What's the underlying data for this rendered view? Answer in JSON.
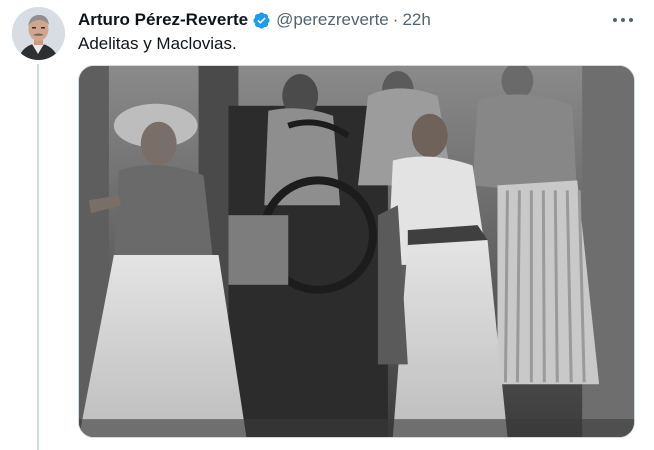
{
  "author": {
    "display_name": "Arturo Pérez-Reverte",
    "handle": "@perezreverte",
    "separator": "·",
    "time": "22h"
  },
  "tweet": {
    "text": "Adelitas y Maclovias."
  },
  "icons": {
    "verified": "verified-badge-icon",
    "more": "more-options-icon"
  },
  "colors": {
    "verified_badge": "#1d9bf0",
    "secondary_text": "#536471",
    "primary_text": "#0f1419",
    "border": "#cfd9de"
  }
}
